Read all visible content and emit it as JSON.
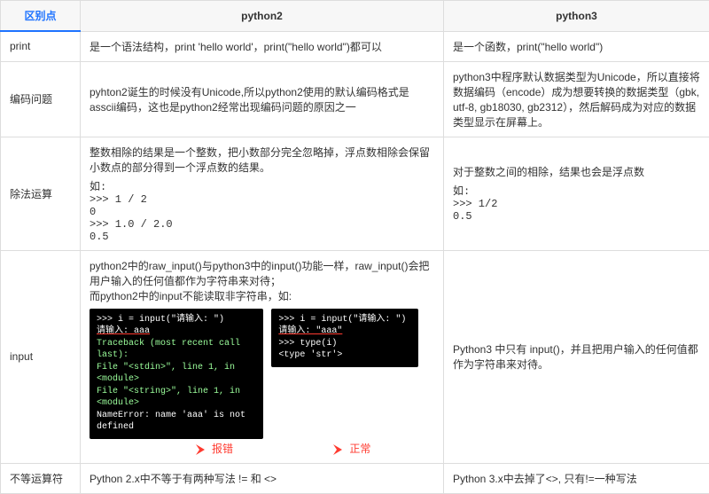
{
  "headers": {
    "col0": "区别点",
    "col1": "python2",
    "col2": "python3"
  },
  "rows": {
    "print": {
      "label": "print",
      "py2": "是一个语法结构，print 'hello world'，print(\"hello world\")都可以",
      "py3": "是一个函数，print(\"hello world\")"
    },
    "encoding": {
      "label": "编码问题",
      "py2": "pyhton2诞生的时候没有Unicode,所以python2使用的默认编码格式是asscii编码，这也是python2经常出现编码问题的原因之一",
      "py3": "python3中程序默认数据类型为Unicode，所以直接将数据编码（encode）成为想要转换的数据类型（gbk, utf-8, gb18030, gb2312），然后解码成为对应的数据类型显示在屏幕上。"
    },
    "division": {
      "label": "除法运算",
      "py2_intro": "整数相除的结果是一个整数，把小数部分完全忽略掉，浮点数相除会保留小数点的部分得到一个浮点数的结果。",
      "py2_code": "如:\n>>> 1 / 2\n0\n>>> 1.0 / 2.0\n0.5",
      "py3_intro": "对于整数之间的相除，结果也会是浮点数",
      "py3_code": "如:\n>>> 1/2\n0.5"
    },
    "input": {
      "label": "input",
      "py2_text": "python2中的raw_input()与python3中的input()功能一样，raw_input()会把用户输入的任何值都作为字符串来对待；\n而python2中的input不能读取非字符串，如:",
      "py3": "Python3 中只有 input()，并且把用户输入的任何值都作为字符串来对待。",
      "term_err": {
        "l1": ">>> i = input(\"请输入: \")",
        "l2": "请输入: aaa",
        "l3": "Traceback (most recent call last):",
        "l4": "  File \"<stdin>\", line 1, in <module>",
        "l5": "  File \"<string>\", line 1, in <module>",
        "l6": "NameError: name 'aaa' is not defined"
      },
      "term_ok": {
        "l1": ">>> i = input(\"请输入: \")",
        "l2": "请输入: \"aaa\"",
        "l3": ">>> type(i)",
        "l4": "<type 'str'>"
      },
      "tag_err": "报错",
      "tag_ok": "正常"
    },
    "neq": {
      "label": "不等运算符",
      "py2": "Python 2.x中不等于有两种写法 != 和 <>",
      "py3": "Python 3.x中去掉了<>, 只有!=一种写法"
    }
  },
  "chart_data": {
    "type": "table",
    "columns": [
      "区别点",
      "python2",
      "python3"
    ],
    "rows": [
      [
        "print",
        "是一个语法结构，print 'hello world'，print(\"hello world\")都可以",
        "是一个函数，print(\"hello world\")"
      ],
      [
        "编码问题",
        "pyhton2诞生的时候没有Unicode,所以python2使用的默认编码格式是asscii编码，这也是python2经常出现编码问题的原因之一",
        "python3中程序默认数据类型为Unicode，所以直接将数据编码（encode）成为想要转换的数据类型（gbk, utf-8, gb18030, gb2312），然后解码成为对应的数据类型显示在屏幕上。"
      ],
      [
        "除法运算",
        "整数相除的结果是一个整数，把小数部分完全忽略掉，浮点数相除会保留小数点的部分得到一个浮点数的结果。 如: >>> 1 / 2 → 0; >>> 1.0 / 2.0 → 0.5",
        "对于整数之间的相除，结果也会是浮点数 如: >>> 1/2 → 0.5"
      ],
      [
        "input",
        "python2中的raw_input()与python3中的input()功能一样，raw_input()会把用户输入的任何值都作为字符串来对待；而python2中的input不能读取非字符串",
        "Python3 中只有 input()，并且把用户输入的任何值都作为字符串来对待。"
      ],
      [
        "不等运算符",
        "Python 2.x中不等于有两种写法 != 和 <>",
        "Python 3.x中去掉了<>, 只有!=一种写法"
      ]
    ]
  }
}
